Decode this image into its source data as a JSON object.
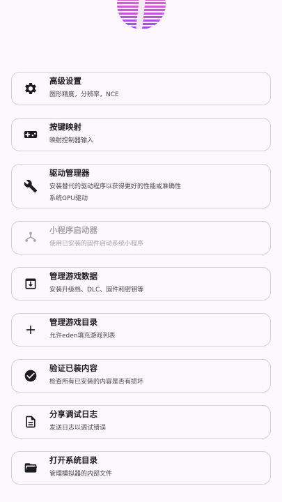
{
  "menu": {
    "items": [
      {
        "key": "advanced-settings",
        "icon": "gear-icon",
        "title": "高级设置",
        "desc": [
          "图形精度，分辨率，NCE"
        ],
        "enabled": true
      },
      {
        "key": "key-mapping",
        "icon": "gamepad-icon",
        "title": "按键映射",
        "desc": [
          "映射控制器输入"
        ],
        "enabled": true
      },
      {
        "key": "driver-manager",
        "icon": "wrench-icon",
        "title": "驱动管理器",
        "desc": [
          "安装替代的驱动程序以获得更好的性能或准确性",
          "系统GPU驱动"
        ],
        "enabled": true
      },
      {
        "key": "applet-launcher",
        "icon": "applet-icon",
        "title": "小程序启动器",
        "desc": [
          "使用已安装的固件启动系统小程序"
        ],
        "enabled": false
      },
      {
        "key": "manage-game-data",
        "icon": "download-box-icon",
        "title": "管理游戏数据",
        "desc": [
          "安装升级档、DLC、固件和密钥等"
        ],
        "enabled": true
      },
      {
        "key": "manage-game-dirs",
        "icon": "plus-icon",
        "title": "管理游戏目录",
        "desc": [
          "允许eden填充游戏列表"
        ],
        "enabled": true
      },
      {
        "key": "verify-content",
        "icon": "check-circle-icon",
        "title": "验证已装内容",
        "desc": [
          "检查所有已安装的内容是否有损坏"
        ],
        "enabled": true
      },
      {
        "key": "share-debug-log",
        "icon": "document-icon",
        "title": "分享调试日志",
        "desc": [
          "发送日志以调试错误"
        ],
        "enabled": true
      },
      {
        "key": "open-system-dir",
        "icon": "folder-open-icon",
        "title": "打开系统目录",
        "desc": [
          "管理模拟器的内部文件"
        ],
        "enabled": true
      }
    ]
  }
}
